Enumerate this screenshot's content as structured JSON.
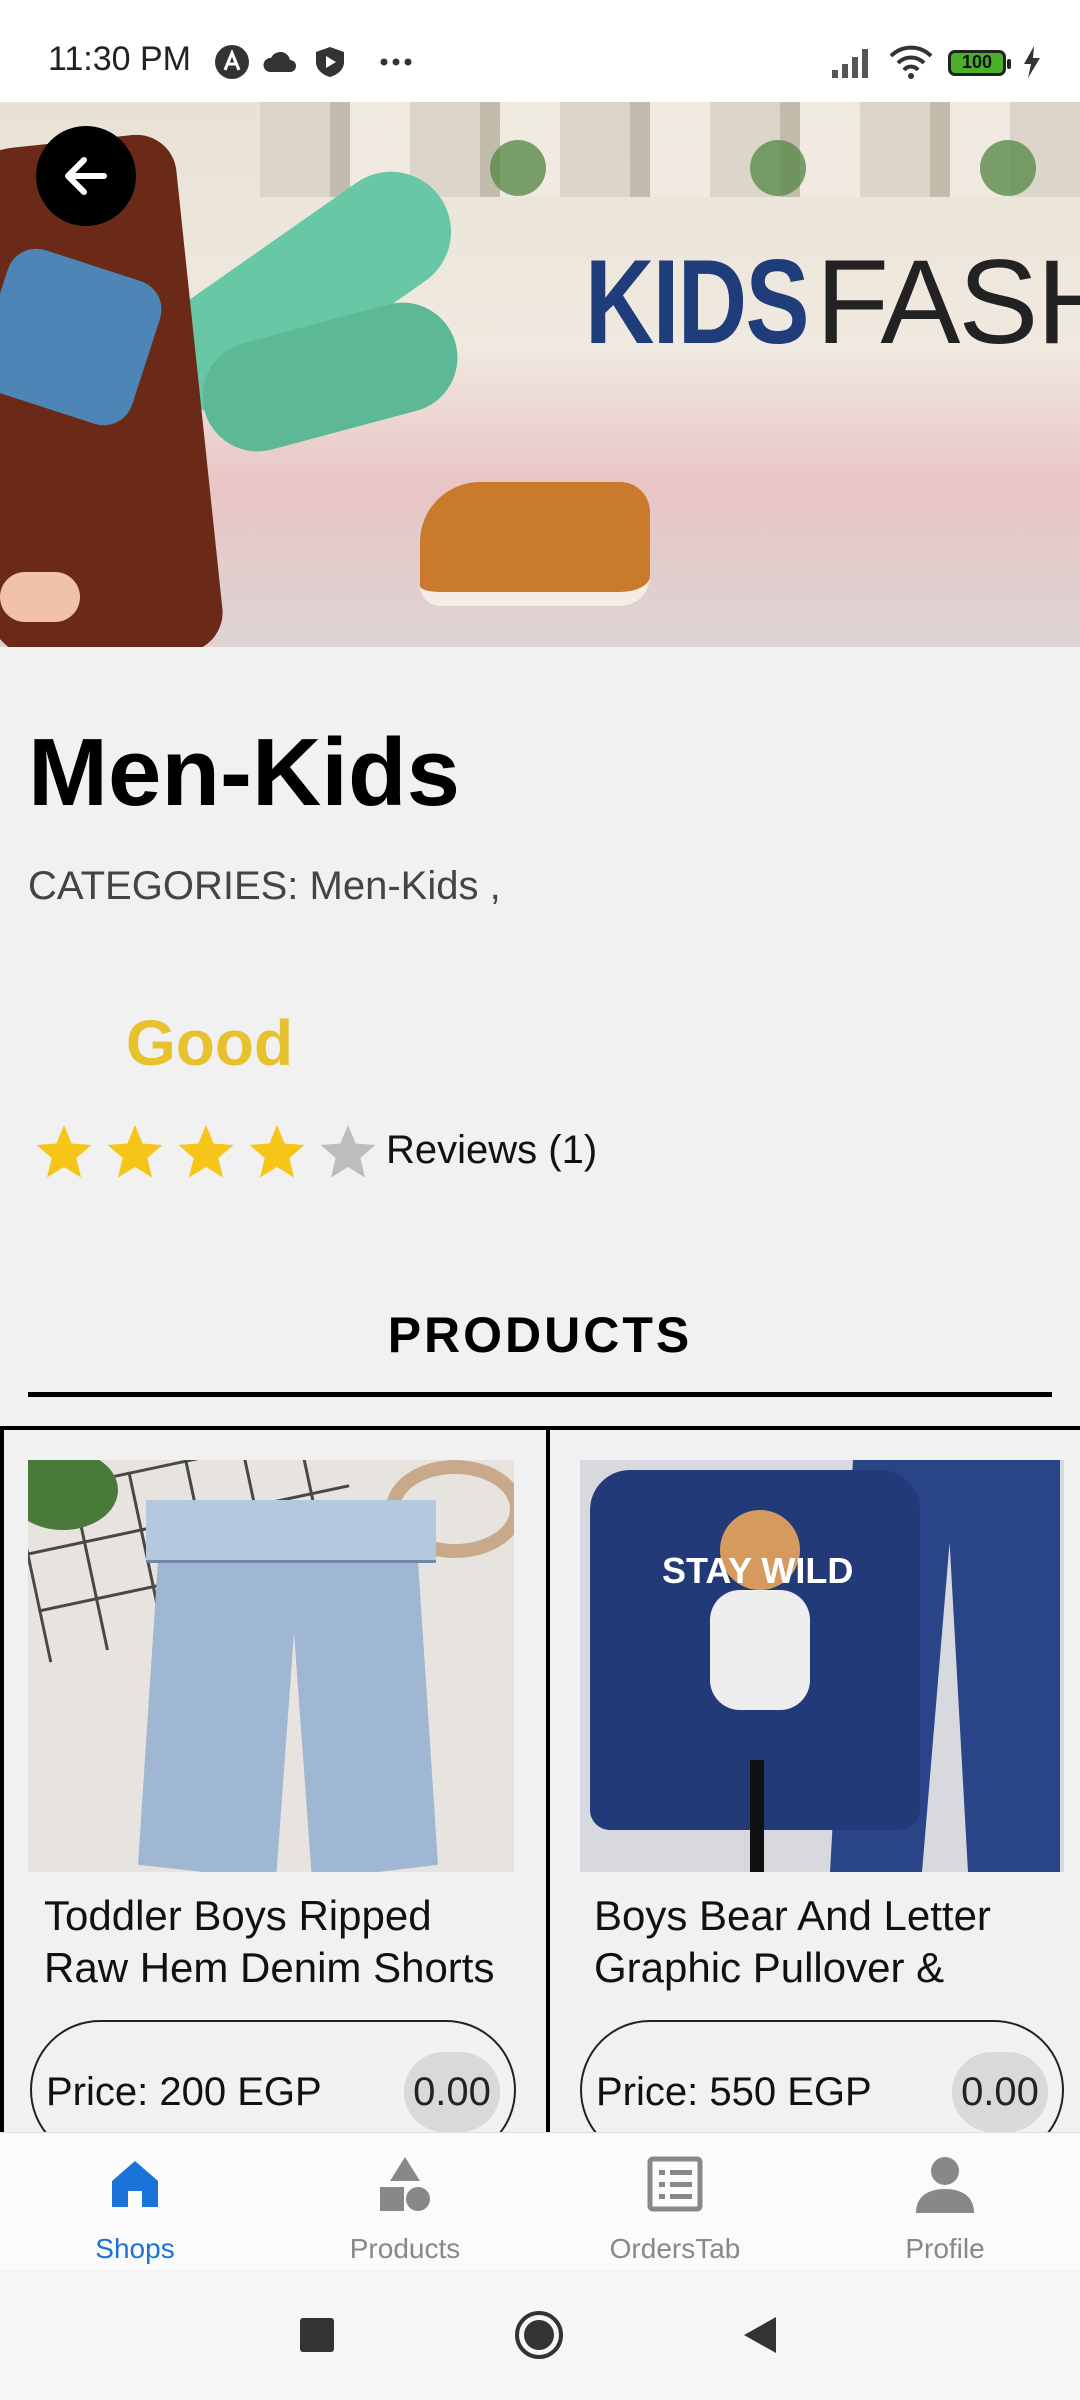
{
  "status_bar": {
    "time": "11:30 PM",
    "battery": "100",
    "icons": [
      "app-icon",
      "cloud-icon",
      "shield-play-icon",
      "more-dots-icon",
      "signal-icon",
      "wifi-icon",
      "battery-icon",
      "charging-icon"
    ]
  },
  "banner": {
    "text_bold": "KIDS",
    "text_light": "FASH"
  },
  "shop": {
    "title": "Men-Kids",
    "categories": "CATEGORIES: Men-Kids ,",
    "rating_word": "Good",
    "rating": 4,
    "rating_max": 5,
    "reviews": "Reviews (1)"
  },
  "products_section": {
    "heading": "PRODUCTS"
  },
  "products": [
    {
      "name": "Toddler Boys Ripped Raw Hem Denim Shorts",
      "price": "Price: 200 EGP",
      "badge": "0.00"
    },
    {
      "name": "Boys Bear And Letter Graphic Pullover & Sweatpants",
      "price": "Price: 550 EGP",
      "badge": "0.00"
    }
  ],
  "product_image_text": "STAY WILD",
  "bottom_nav": [
    {
      "label": "Shops",
      "icon": "home-icon",
      "active": true
    },
    {
      "label": "Products",
      "icon": "shapes-icon",
      "active": false
    },
    {
      "label": "OrdersTab",
      "icon": "list-icon",
      "active": false
    },
    {
      "label": "Profile",
      "icon": "person-icon",
      "active": false
    }
  ],
  "colors": {
    "accent": "#1a73d9",
    "rating_gold": "#e8c12e",
    "star_filled": "#f5c518",
    "star_empty": "#bdbdbd"
  }
}
